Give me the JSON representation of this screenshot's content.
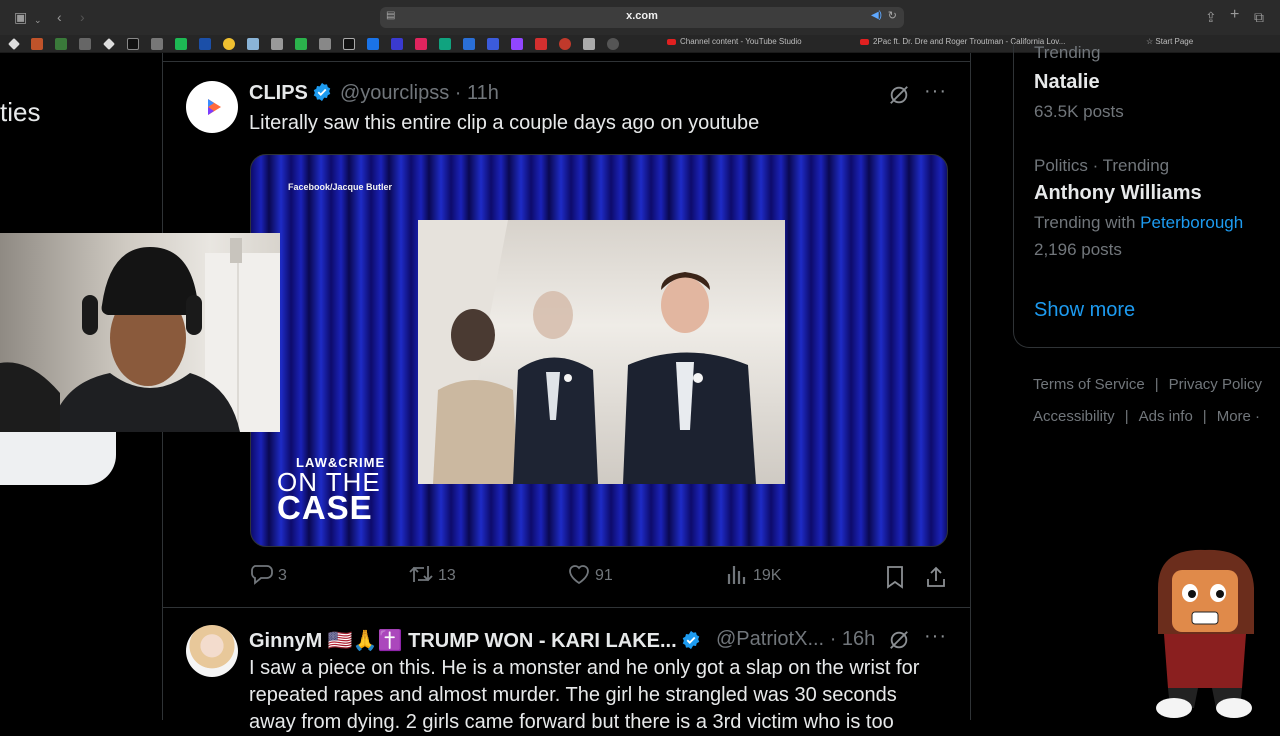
{
  "browser": {
    "url": "x.com",
    "tabs": [
      {
        "label": "Channel content - YouTube Studio"
      },
      {
        "label": "2Pac ft. Dr. Dre and Roger Troutman - California Lov..."
      },
      {
        "label": "Start Page"
      }
    ]
  },
  "left_column": {
    "fragment": "ties"
  },
  "tweet1": {
    "name": "CLIPS",
    "handle": "@yourclipss",
    "time": "· 11h",
    "text": "Literally saw this entire clip a couple days ago on youtube",
    "media": {
      "credit": "Facebook/Jacque Butler",
      "logo_line1": "LAW&CRIME",
      "logo_line2": "ON THE",
      "logo_line3": "CASE"
    },
    "actions": {
      "replies": "3",
      "reposts": "13",
      "likes": "91",
      "views": "19K"
    }
  },
  "tweet2": {
    "name": "GinnyM 🇺🇸🙏✝️ TRUMP WON - KARI LAKE...",
    "handle": "@PatriotX...",
    "time": "· 16h",
    "text": "I saw a piece on this. He is a monster and he only got a slap on the wrist for repeated rapes and almost murder. The girl he strangled was 30 seconds away from dying. 2 girls came forward but there is a 3rd victim who is too"
  },
  "trends": {
    "top_partial_label": "Trending",
    "items": [
      {
        "name": "Natalie",
        "count": "63.5K posts"
      },
      {
        "category": "Politics · Trending",
        "name": "Anthony Williams",
        "trending_with_label": "Trending with",
        "trending_with": "Peterborough",
        "count": "2,196 posts"
      }
    ],
    "show_more": "Show more"
  },
  "footer": {
    "links": [
      "Terms of Service",
      "Privacy Policy",
      "Accessibility",
      "Ads info",
      "More ·"
    ]
  },
  "colors": {
    "accent": "#1d9bf0",
    "background": "#000000",
    "muted": "#71767b",
    "text": "#e7e9ea"
  }
}
